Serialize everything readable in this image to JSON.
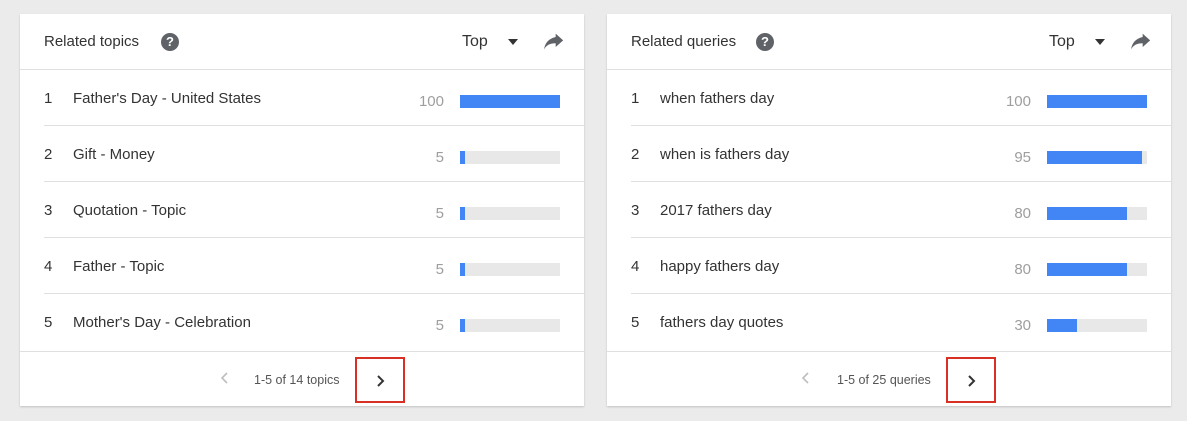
{
  "colors": {
    "bar": "#4285f4",
    "track": "#e8e8e8",
    "highlight": "#d93025"
  },
  "topics": {
    "title": "Related topics",
    "help_icon": "?",
    "select_label": "Top",
    "pager": "1-5 of 14 topics",
    "rows": [
      {
        "rank": "1",
        "label": "Father's Day - United States",
        "value": "100",
        "fill": 1.0
      },
      {
        "rank": "2",
        "label": "Gift - Money",
        "value": "5",
        "fill": 0.05
      },
      {
        "rank": "3",
        "label": "Quotation - Topic",
        "value": "5",
        "fill": 0.05
      },
      {
        "rank": "4",
        "label": "Father - Topic",
        "value": "5",
        "fill": 0.05
      },
      {
        "rank": "5",
        "label": "Mother's Day - Celebration",
        "value": "5",
        "fill": 0.05
      }
    ]
  },
  "queries": {
    "title": "Related queries",
    "help_icon": "?",
    "select_label": "Top",
    "pager": "1-5 of 25 queries",
    "rows": [
      {
        "rank": "1",
        "label": "when fathers day",
        "value": "100",
        "fill": 1.0
      },
      {
        "rank": "2",
        "label": "when is fathers day",
        "value": "95",
        "fill": 0.95
      },
      {
        "rank": "3",
        "label": "2017 fathers day",
        "value": "80",
        "fill": 0.8
      },
      {
        "rank": "4",
        "label": "happy fathers day",
        "value": "80",
        "fill": 0.8
      },
      {
        "rank": "5",
        "label": "fathers day quotes",
        "value": "30",
        "fill": 0.3
      }
    ]
  }
}
